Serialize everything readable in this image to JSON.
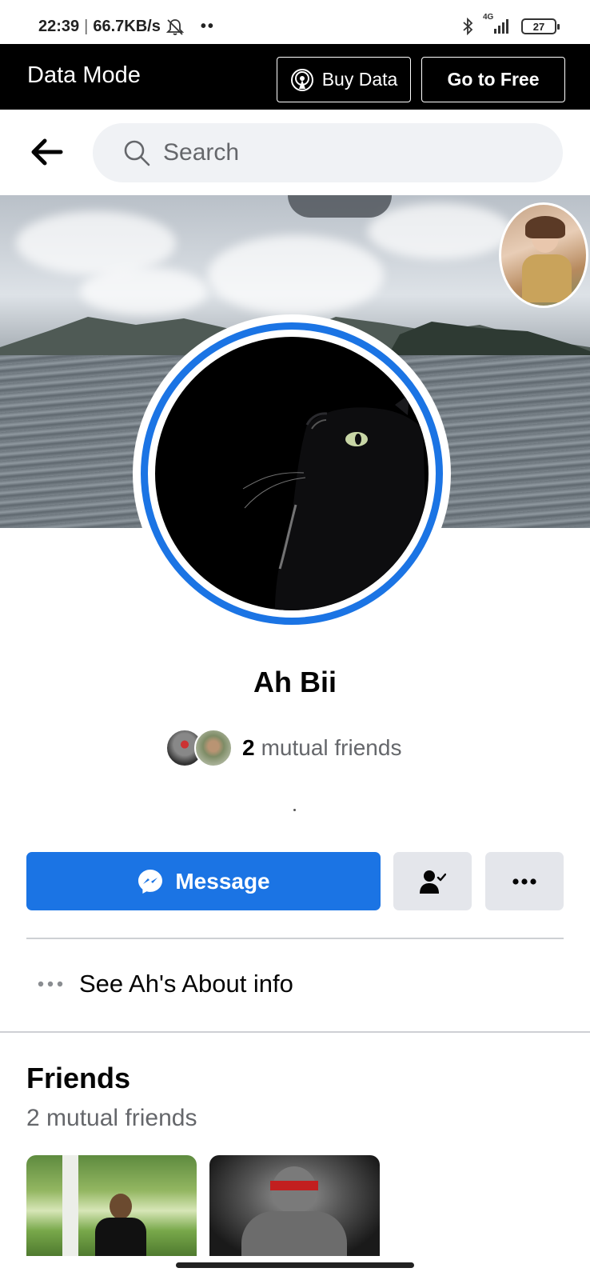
{
  "status_bar": {
    "time": "22:39",
    "speed": "66.7KB/s",
    "more": "••",
    "network": "4G",
    "battery": "27"
  },
  "data_bar": {
    "title": "Data Mode",
    "buy_label": "Buy Data",
    "free_label": "Go to Free"
  },
  "header": {
    "search_placeholder": "Search"
  },
  "profile": {
    "name": "Ah Bii",
    "mutual_count": "2",
    "mutual_label": "mutual friends",
    "separator_dot": "·"
  },
  "actions": {
    "message_label": "Message"
  },
  "about": {
    "label": "See Ah's About info"
  },
  "friends": {
    "title": "Friends",
    "subtitle": "2 mutual friends"
  },
  "colors": {
    "accent": "#1b74e4",
    "secondary_button": "#e4e6eb",
    "secondary_text": "#65676b"
  }
}
